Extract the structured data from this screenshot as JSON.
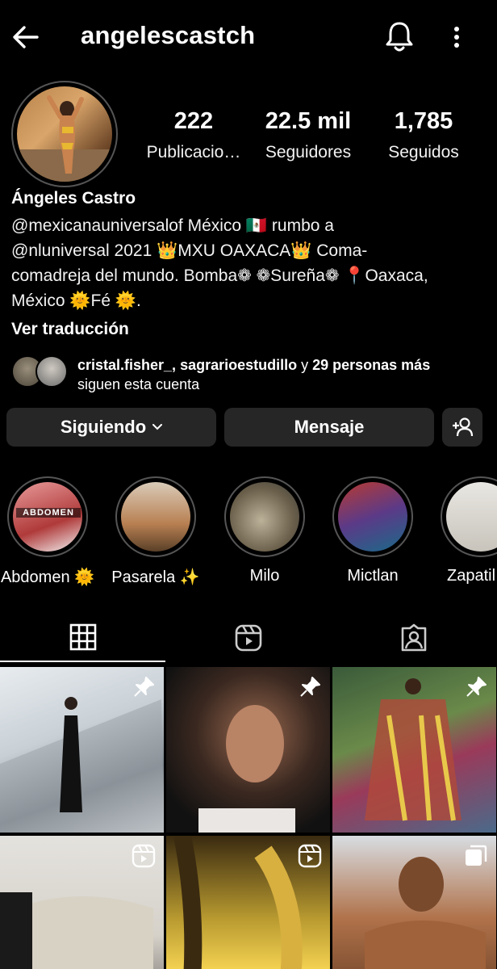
{
  "header": {
    "username": "angelescastch",
    "back_icon": "arrow-left-icon",
    "bell_icon": "bell-icon",
    "menu_icon": "more-vertical-icon"
  },
  "stats": {
    "posts": {
      "value": "222",
      "label": "Publicacio…"
    },
    "followers": {
      "value": "22.5 mil",
      "label": "Seguidores"
    },
    "following": {
      "value": "1,785",
      "label": "Seguidos"
    }
  },
  "profile": {
    "name": "Ángeles Castro",
    "bio_lines": [
      "@mexicanauniversalof México 🇲🇽 rumbo a",
      "@nluniversal  2021 👑MXU OAXACA👑 Coma-",
      "comadreja del mundo. Bomba❁ ❁Sureña❁ 📍Oaxaca,",
      "México 🌞Fé 🌞."
    ],
    "translate": "Ver traducción"
  },
  "mutual": {
    "names": "cristal.fisher_, sagrarioestudillo",
    "connector": " y ",
    "more": "29 personas más",
    "line2": "siguen esta cuenta"
  },
  "actions": {
    "following_label": "Siguiendo",
    "message_label": "Mensaje",
    "add_user_icon": "add-user-icon"
  },
  "highlights": [
    {
      "label": "Abdomen 🌞"
    },
    {
      "label": "Pasarela ✨"
    },
    {
      "label": "Milo"
    },
    {
      "label": "Mictlan"
    },
    {
      "label": "Zapatil"
    }
  ],
  "highlight_texts": {
    "abdomen_cover": "ABDOMEN"
  },
  "tabs": [
    {
      "name": "grid-icon",
      "active": true
    },
    {
      "name": "reels-icon",
      "active": false
    },
    {
      "name": "tagged-icon",
      "active": false
    }
  ],
  "posts": [
    {
      "badge": "pin-icon"
    },
    {
      "badge": "pin-icon"
    },
    {
      "badge": "pin-icon"
    },
    {
      "badge": "reels-icon"
    },
    {
      "badge": "reels-icon"
    },
    {
      "badge": "carousel-icon"
    }
  ],
  "colors": {
    "background": "#000000",
    "button_bg": "#262626",
    "text": "#ffffff"
  }
}
